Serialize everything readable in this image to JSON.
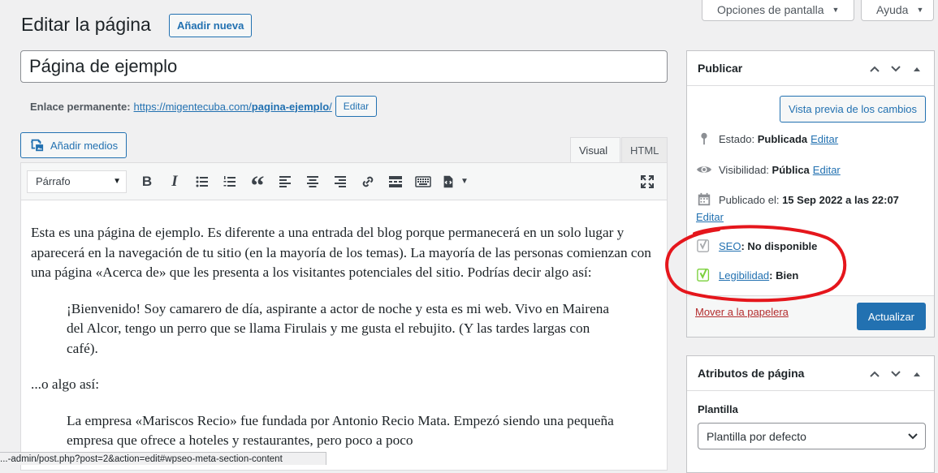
{
  "header": {
    "screen_options": "Opciones de pantalla",
    "help": "Ayuda",
    "page_title": "Editar la página",
    "add_new": "Añadir nueva"
  },
  "post": {
    "title": "Página de ejemplo",
    "permalink_label": "Enlace permanente:",
    "permalink_base": "https://migentecuba.com/",
    "permalink_slug": "pagina-ejemplo",
    "permalink_trail": "/",
    "permalink_edit": "Editar"
  },
  "editor": {
    "add_media": "Añadir medios",
    "tab_visual": "Visual",
    "tab_html": "HTML",
    "format": "Párrafo",
    "toolbar_icons": [
      "bold-icon",
      "italic-icon",
      "bullet-list-icon",
      "numbered-list-icon",
      "blockquote-icon",
      "align-left-icon",
      "align-center-icon",
      "align-right-icon",
      "link-icon",
      "read-more-icon",
      "toolbar-toggle-icon",
      "shortcode-icon",
      "fullscreen-icon"
    ],
    "paragraphs": {
      "p1": "Esta es una página de ejemplo. Es diferente a una entrada del blog porque permanecerá en un solo lugar y aparecerá en la navegación de tu sitio (en la mayoría de los temas). La mayoría de las personas comienzan con una página «Acerca de» que les presenta a los visitantes potenciales del sitio. Podrías decir algo así:",
      "q1": "¡Bienvenido! Soy camarero de día, aspirante a actor de noche y esta es mi web. Vivo en Mairena del Alcor, tengo un perro que se llama Firulais y me gusta el rebujito. (Y las tardes largas con café).",
      "p2": "...o algo así:",
      "q2": "La empresa «Mariscos Recio» fue fundada por Antonio Recio Mata. Empezó siendo una pequeña empresa que ofrece a hoteles y restaurantes, pero poco a poco"
    },
    "status_url": "...-admin/post.php?post=2&action=edit#wpseo-meta-section-content"
  },
  "publish": {
    "title": "Publicar",
    "preview": "Vista previa de los cambios",
    "status_label": "Estado:",
    "status_value": "Publicada",
    "visibility_label": "Visibilidad:",
    "visibility_value": "Pública",
    "published_label": "Publicado el:",
    "published_value": "15 Sep 2022 a las 22:07",
    "edit": "Editar",
    "seo_link": "SEO",
    "seo_value": ": No disponible",
    "readability_link": "Legibilidad",
    "readability_value": ": Bien",
    "trash": "Mover a la papelera",
    "update": "Actualizar",
    "colors": {
      "seo_na": "#a7aaad",
      "readability_good": "#7ad03a",
      "annotation": "#e5161c"
    }
  },
  "attributes": {
    "title": "Atributos de página",
    "template_label": "Plantilla",
    "template_value": "Plantilla por defecto"
  }
}
